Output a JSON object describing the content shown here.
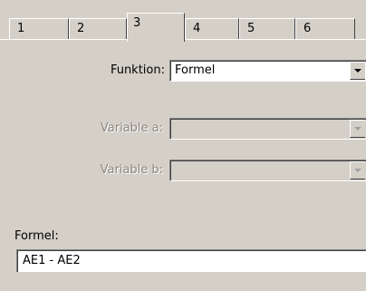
{
  "tabs": [
    {
      "label": "1"
    },
    {
      "label": "2"
    },
    {
      "label": "3"
    },
    {
      "label": "4"
    },
    {
      "label": "5"
    },
    {
      "label": "6"
    }
  ],
  "active_tab": "3",
  "form": {
    "funktion_label": "Funktion:",
    "funktion_value": "Formel",
    "variable_a_label": "Variable a:",
    "variable_a_value": "",
    "variable_b_label": "Variable b:",
    "variable_b_value": "",
    "formel_label": "Formel:",
    "formel_value": "AE1 - AE2"
  },
  "colors": {
    "face": "#d4d0c8",
    "disabled_text": "#8b8680",
    "field_background": "#ffffff"
  }
}
